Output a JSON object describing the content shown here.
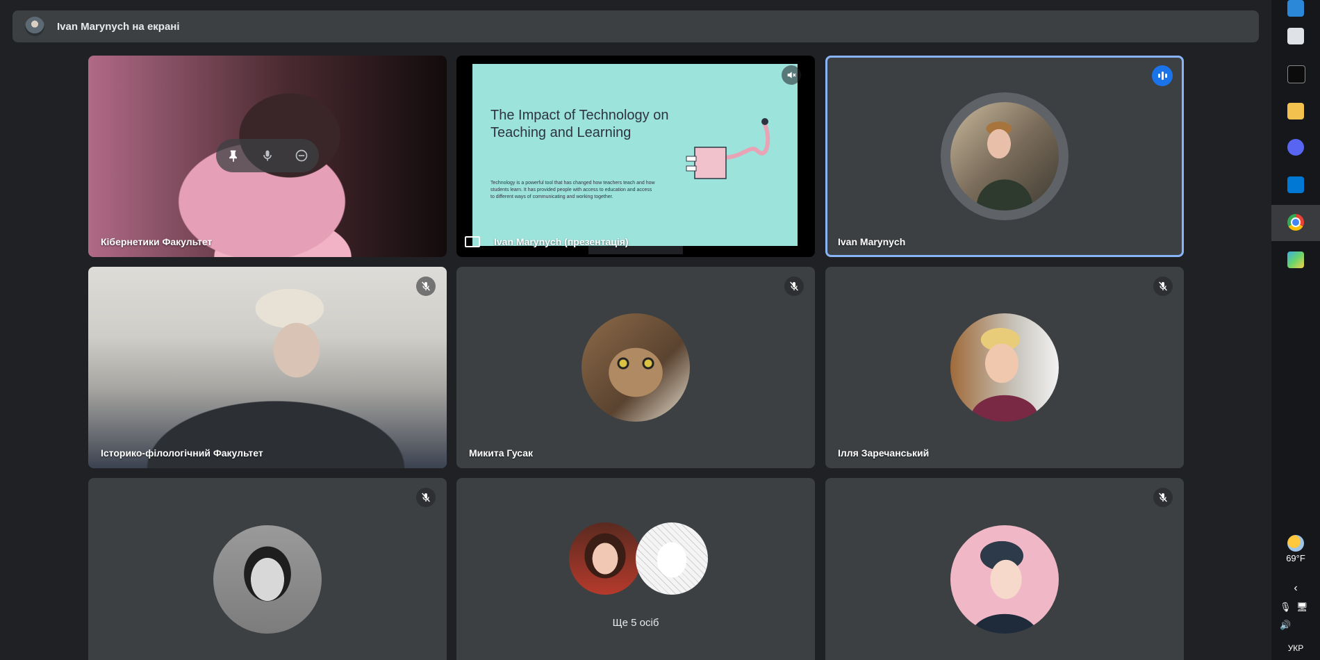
{
  "topbar": {
    "presenting_text": "Ivan Marynych на екрані"
  },
  "tiles": {
    "t1": {
      "name": "Кібернетики Факультет"
    },
    "t2": {
      "name": "Ivan Marynych (презентація)",
      "slide_title": "The Impact of Technology on Teaching and Learning",
      "slide_body": "Technology is a powerful tool that has changed how teachers teach and how students learn. It has provided people with access to education and access to different ways of communicating and working together."
    },
    "t3": {
      "name": "Ivan Marynych"
    },
    "t4": {
      "name": "Історико-філологічний Факультет"
    },
    "t5": {
      "name": "Микита Гусак"
    },
    "t6": {
      "name": "Ілля Заречанський"
    },
    "t8": {
      "more_label": "Ще 5 осіб"
    }
  },
  "taskbar": {
    "icons": [
      "mail-app-icon",
      "notepad-icon",
      "terminal-icon",
      "file-explorer-icon",
      "discord-icon",
      "vscode-icon",
      "chrome-icon",
      "paint-icon"
    ],
    "weather_temp": "69°F",
    "language": "УКР"
  },
  "colors": {
    "active_border": "#8ab4f8",
    "speaking": "#1a73e8",
    "tile_bg": "#3c4043",
    "page_bg": "#202124"
  }
}
